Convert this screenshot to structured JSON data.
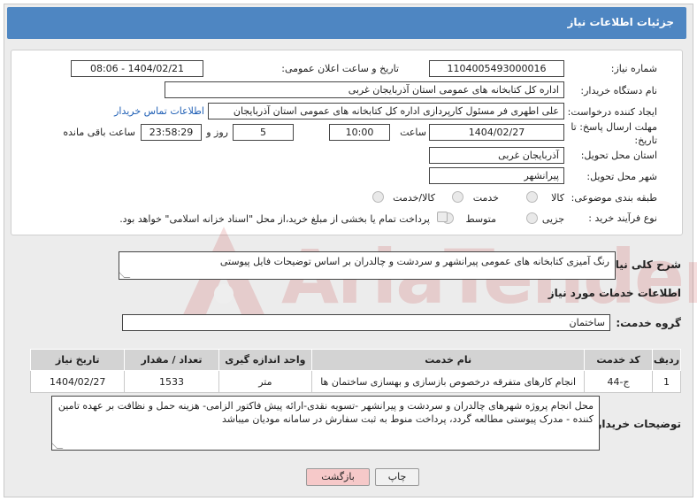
{
  "header": {
    "title": "جزئیات اطلاعات نیاز"
  },
  "fields": {
    "need_number_label": "شماره نیاز:",
    "need_number": "1104005493000016",
    "announce_label": "تاریخ و ساعت اعلان عمومی:",
    "announce_value": "1404/02/21 - 08:06",
    "buyer_org_label": "نام دستگاه خریدار:",
    "buyer_org": "اداره کل کتابخانه های عمومی استان آذربایجان غربی",
    "requester_label": "ایجاد کننده درخواست:",
    "requester": "علی اطهری فر مسئول کارپردازی اداره کل کتابخانه های عمومی استان آذربایجان",
    "contact_link": "اطلاعات تماس خریدار",
    "deadline_label_1": "مهلت ارسال پاسخ: تا",
    "deadline_label_2": "تاریخ:",
    "deadline_date": "1404/02/27",
    "time_label": "ساعت",
    "deadline_time": "10:00",
    "days_value": "5",
    "days_label": "روز و",
    "remaining_time": "23:58:29",
    "remaining_label": "ساعت باقی مانده",
    "province_label": "استان محل تحویل:",
    "province": "آذربایجان غربی",
    "city_label": "شهر محل تحویل:",
    "city": "پیرانشهر",
    "category_label": "طبقه بندی موضوعی:",
    "category_options": [
      "کالا",
      "خدمت",
      "کالا/خدمت"
    ],
    "process_label": "نوع فرآیند خرید :",
    "process_options": [
      "جزیی",
      "متوسط"
    ],
    "payment_note": "پرداخت تمام یا بخشی از مبلغ خرید،از محل \"اسناد خزانه اسلامی\" خواهد بود."
  },
  "summary": {
    "label": "شرح کلی نیاز:",
    "text": "رنگ آمیزی کتابخانه های عمومی پیرانشهر و سردشت و چالدران بر اساس توضیحات فایل پیوستی"
  },
  "services": {
    "section_title": "اطلاعات خدمات مورد نیاز",
    "group_label": "گروه خدمت:",
    "group_value": "ساختمان",
    "columns": [
      "ردیف",
      "کد خدمت",
      "نام خدمت",
      "واحد اندازه گیری",
      "تعداد / مقدار",
      "تاریخ نیاز"
    ],
    "rows": [
      [
        "1",
        "ج-44",
        "انجام کارهای متفرقه درخصوص بازسازی و بهسازی ساختمان ها",
        "متر",
        "1533",
        "1404/02/27"
      ]
    ]
  },
  "buyer_notes": {
    "label": "توضیحات خریدار:",
    "text": "محل انجام پروژه شهرهای چالدران و سردشت و پیرانشهر -تسویه نقدی-ارائه پیش فاکتور الزامی- هزینه حمل و نظافت  بر عهده تامین کننده -  مدرک پیوستی مطالعه گردد، پرداخت منوط به ثبت سفارش در سامانه مودیان میباشد"
  },
  "buttons": {
    "print": "چاپ",
    "back": "بازگشت"
  },
  "watermark": {
    "text": "AriaTender.neT"
  },
  "colors": {
    "header": "#4e86c2",
    "back_button": "#f6c9c9",
    "link": "#1f5fb5"
  }
}
